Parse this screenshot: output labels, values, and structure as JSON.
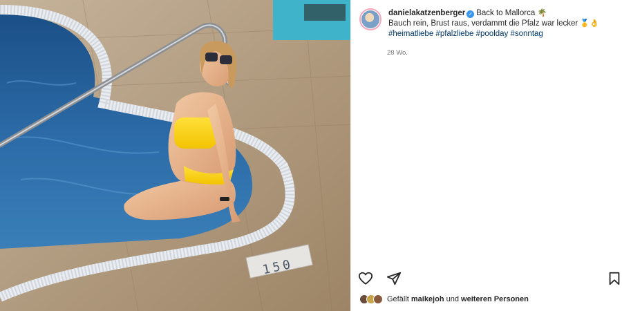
{
  "post": {
    "username": "danielakatzenberger",
    "caption_title": "Back to Mallorca",
    "caption_title_emoji": "🌴",
    "caption_body": "Bauch rein, Brust raus, verdammt die Pfalz war lecker",
    "caption_body_emojis": "🥇👌",
    "hashtags": [
      "#heimatliebe",
      "#pfalzliebe",
      "#poolday",
      "#sonntag"
    ],
    "timestamp": "28 Wo.",
    "pool_marker": "150",
    "likes": {
      "prefix": "Gefällt",
      "user": "maikejoh",
      "connector": "und",
      "suffix": "weiteren Personen"
    }
  },
  "icons": {
    "like": "heart-icon",
    "share": "send-icon",
    "save": "bookmark-icon",
    "verified": "verified-badge-icon"
  },
  "colors": {
    "hashtag": "#00376b",
    "verified": "#3897f0",
    "timestamp": "#737373"
  }
}
